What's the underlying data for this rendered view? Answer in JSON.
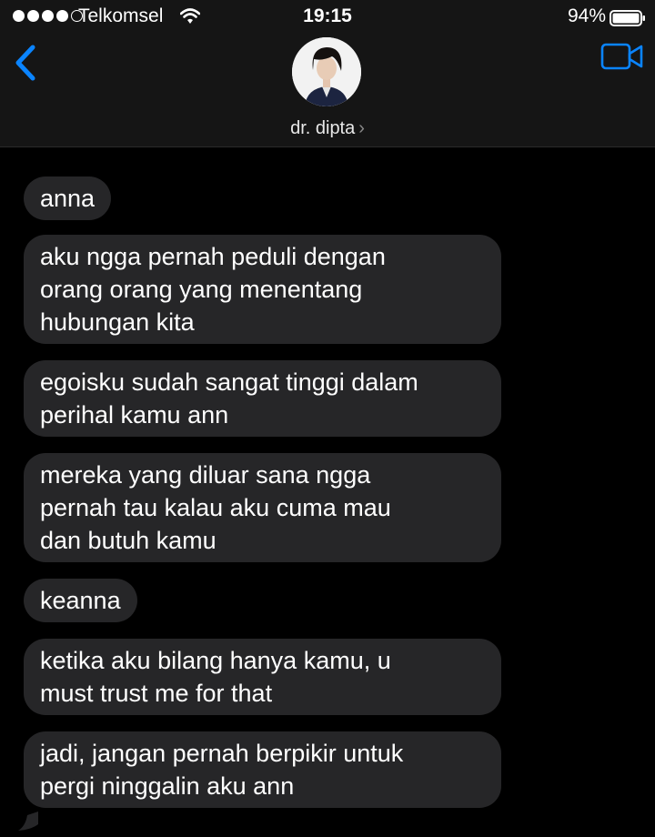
{
  "status_bar": {
    "carrier": "Telkomsel",
    "time": "19:15",
    "battery": "94%"
  },
  "header": {
    "contact_name": "dr. dipta",
    "chevron": "›",
    "icons": [
      "back-chevron-icon",
      "video-call-icon",
      "avatar"
    ]
  },
  "messages": [
    {
      "text": "anna"
    },
    {
      "text": "aku ngga pernah peduli dengan\norang orang yang menentang\nhubungan kita"
    },
    {
      "text": "egoisku sudah sangat tinggi dalam\nperihal kamu ann"
    },
    {
      "text": "mereka yang diluar sana ngga\npernah tau kalau aku cuma mau\ndan butuh kamu"
    },
    {
      "text": "keanna"
    },
    {
      "text": "ketika aku bilang hanya kamu, u\nmust trust me for that"
    },
    {
      "text": "jadi, jangan pernah berpikir untuk\npergi ninggalin aku ann"
    }
  ],
  "colors": {
    "accent": "#0a84ff",
    "bubble": "#262628",
    "header_bg": "#151515",
    "background": "#000000"
  }
}
